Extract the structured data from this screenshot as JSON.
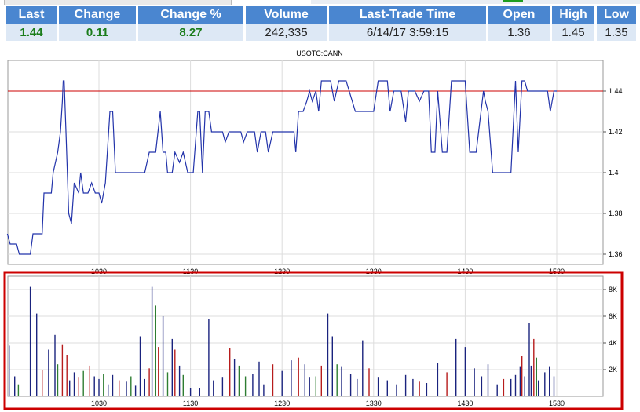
{
  "quote": {
    "headers": [
      "Last",
      "Change",
      "Change %",
      "Volume",
      "Last-Trade Time",
      "Open",
      "High",
      "Low"
    ],
    "values": [
      "1.44",
      "0.11",
      "8.27",
      "242,335",
      "6/14/17 3:59:15",
      "1.36",
      "1.45",
      "1.35"
    ]
  },
  "chart_data": [
    {
      "type": "line",
      "title": "USOTC:CANN",
      "x_ticks": [
        "1030",
        "1130",
        "1230",
        "1330",
        "1430",
        "1530"
      ],
      "y_ticks": [
        "1.44",
        "1.42",
        "1.4",
        "1.38",
        "1.36"
      ],
      "ylim": [
        1.355,
        1.455
      ],
      "reference_line": 1.44,
      "grid": true,
      "series": [
        {
          "color": "#2233aa",
          "points": [
            [
              9.5,
              1.37
            ],
            [
              9.53,
              1.365
            ],
            [
              9.6,
              1.365
            ],
            [
              9.63,
              1.36
            ],
            [
              9.75,
              1.36
            ],
            [
              9.78,
              1.37
            ],
            [
              9.88,
              1.37
            ],
            [
              9.9,
              1.39
            ],
            [
              9.98,
              1.39
            ],
            [
              10.0,
              1.4
            ],
            [
              10.05,
              1.41
            ],
            [
              10.08,
              1.42
            ],
            [
              10.1,
              1.435
            ],
            [
              10.11,
              1.445
            ],
            [
              10.12,
              1.445
            ],
            [
              10.14,
              1.42
            ],
            [
              10.17,
              1.38
            ],
            [
              10.2,
              1.375
            ],
            [
              10.23,
              1.395
            ],
            [
              10.28,
              1.39
            ],
            [
              10.3,
              1.4
            ],
            [
              10.33,
              1.39
            ],
            [
              10.38,
              1.39
            ],
            [
              10.42,
              1.395
            ],
            [
              10.46,
              1.39
            ],
            [
              10.5,
              1.39
            ],
            [
              10.53,
              1.385
            ],
            [
              10.57,
              1.395
            ],
            [
              10.62,
              1.43
            ],
            [
              10.65,
              1.43
            ],
            [
              10.68,
              1.4
            ],
            [
              10.78,
              1.4
            ],
            [
              10.92,
              1.4
            ],
            [
              10.97,
              1.4
            ],
            [
              11.0,
              1.4
            ],
            [
              11.05,
              1.41
            ],
            [
              11.12,
              1.41
            ],
            [
              11.17,
              1.43
            ],
            [
              11.2,
              1.41
            ],
            [
              11.23,
              1.41
            ],
            [
              11.25,
              1.4
            ],
            [
              11.3,
              1.4
            ],
            [
              11.33,
              1.41
            ],
            [
              11.38,
              1.405
            ],
            [
              11.42,
              1.41
            ],
            [
              11.47,
              1.4
            ],
            [
              11.53,
              1.4
            ],
            [
              11.58,
              1.43
            ],
            [
              11.6,
              1.43
            ],
            [
              11.63,
              1.4
            ],
            [
              11.66,
              1.43
            ],
            [
              11.7,
              1.43
            ],
            [
              11.73,
              1.42
            ],
            [
              11.85,
              1.42
            ],
            [
              11.88,
              1.415
            ],
            [
              11.92,
              1.42
            ],
            [
              12.05,
              1.42
            ],
            [
              12.08,
              1.415
            ],
            [
              12.12,
              1.42
            ],
            [
              12.2,
              1.42
            ],
            [
              12.23,
              1.41
            ],
            [
              12.27,
              1.42
            ],
            [
              12.32,
              1.42
            ],
            [
              12.35,
              1.41
            ],
            [
              12.4,
              1.42
            ],
            [
              12.5,
              1.42
            ],
            [
              12.63,
              1.42
            ],
            [
              12.65,
              1.41
            ],
            [
              12.68,
              1.43
            ],
            [
              12.73,
              1.43
            ],
            [
              12.77,
              1.435
            ],
            [
              12.8,
              1.44
            ],
            [
              12.83,
              1.435
            ],
            [
              12.87,
              1.44
            ],
            [
              12.9,
              1.43
            ],
            [
              12.93,
              1.445
            ],
            [
              12.98,
              1.445
            ],
            [
              13.03,
              1.445
            ],
            [
              13.07,
              1.435
            ],
            [
              13.12,
              1.445
            ],
            [
              13.2,
              1.445
            ],
            [
              13.3,
              1.43
            ],
            [
              13.45,
              1.43
            ],
            [
              13.5,
              1.43
            ],
            [
              13.55,
              1.445
            ],
            [
              13.65,
              1.445
            ],
            [
              13.68,
              1.43
            ],
            [
              13.72,
              1.44
            ],
            [
              13.8,
              1.44
            ],
            [
              13.85,
              1.425
            ],
            [
              13.88,
              1.44
            ],
            [
              13.95,
              1.44
            ],
            [
              14.0,
              1.435
            ],
            [
              14.05,
              1.44
            ],
            [
              14.1,
              1.44
            ],
            [
              14.13,
              1.41
            ],
            [
              14.17,
              1.41
            ],
            [
              14.2,
              1.44
            ],
            [
              14.25,
              1.41
            ],
            [
              14.3,
              1.41
            ],
            [
              14.35,
              1.445
            ],
            [
              14.5,
              1.445
            ],
            [
              14.55,
              1.41
            ],
            [
              14.62,
              1.41
            ],
            [
              14.7,
              1.44
            ],
            [
              14.72,
              1.435
            ],
            [
              14.75,
              1.43
            ],
            [
              14.8,
              1.4
            ],
            [
              14.95,
              1.4
            ],
            [
              15.0,
              1.4
            ],
            [
              15.05,
              1.445
            ],
            [
              15.08,
              1.41
            ],
            [
              15.12,
              1.445
            ],
            [
              15.15,
              1.445
            ],
            [
              15.18,
              1.44
            ],
            [
              15.25,
              1.44
            ],
            [
              15.4,
              1.44
            ],
            [
              15.43,
              1.43
            ],
            [
              15.47,
              1.44
            ],
            [
              15.5,
              1.44
            ]
          ]
        }
      ]
    },
    {
      "type": "bar",
      "x_ticks": [
        "1030",
        "1130",
        "1230",
        "1330",
        "1430",
        "1530"
      ],
      "y_ticks": [
        "8K",
        "6K",
        "4K",
        "2K"
      ],
      "ylim": [
        0,
        9000
      ],
      "grid": true,
      "series": [
        {
          "name": "",
          "bars": [
            [
              9.52,
              3800,
              "#1a237e"
            ],
            [
              9.58,
              1500,
              "#1a237e"
            ],
            [
              9.62,
              900,
              "#2e7d32"
            ],
            [
              9.75,
              8200,
              "#1a237e"
            ],
            [
              9.82,
              6200,
              "#1a237e"
            ],
            [
              9.88,
              2000,
              "#b71c1c"
            ],
            [
              9.95,
              3500,
              "#1a237e"
            ],
            [
              10.02,
              4600,
              "#1a237e"
            ],
            [
              10.05,
              2400,
              "#2e7d32"
            ],
            [
              10.1,
              3900,
              "#b71c1c"
            ],
            [
              10.15,
              3100,
              "#b71c1c"
            ],
            [
              10.18,
              1200,
              "#1a237e"
            ],
            [
              10.23,
              1800,
              "#1a237e"
            ],
            [
              10.28,
              1400,
              "#b71c1c"
            ],
            [
              10.33,
              1900,
              "#2e7d32"
            ],
            [
              10.4,
              2300,
              "#b71c1c"
            ],
            [
              10.45,
              1500,
              "#1a237e"
            ],
            [
              10.5,
              1300,
              "#1a237e"
            ],
            [
              10.55,
              1700,
              "#2e7d32"
            ],
            [
              10.6,
              900,
              "#1a237e"
            ],
            [
              10.65,
              1600,
              "#1a237e"
            ],
            [
              10.72,
              1200,
              "#b71c1c"
            ],
            [
              10.8,
              1100,
              "#1a237e"
            ],
            [
              10.85,
              1500,
              "#2e7d32"
            ],
            [
              10.9,
              800,
              "#1a237e"
            ],
            [
              10.95,
              4500,
              "#1a237e"
            ],
            [
              11.0,
              1300,
              "#1a237e"
            ],
            [
              11.05,
              2100,
              "#b71c1c"
            ],
            [
              11.08,
              8200,
              "#1a237e"
            ],
            [
              11.12,
              6800,
              "#2e7d32"
            ],
            [
              11.15,
              3700,
              "#b71c1c"
            ],
            [
              11.2,
              6000,
              "#1a237e"
            ],
            [
              11.25,
              1800,
              "#2e7d32"
            ],
            [
              11.3,
              4300,
              "#1a237e"
            ],
            [
              11.33,
              3500,
              "#b71c1c"
            ],
            [
              11.38,
              2300,
              "#1a237e"
            ],
            [
              11.42,
              1600,
              "#2e7d32"
            ],
            [
              11.5,
              600,
              "#1a237e"
            ],
            [
              11.6,
              600,
              "#1a237e"
            ],
            [
              11.7,
              5800,
              "#1a237e"
            ],
            [
              11.75,
              1200,
              "#1a237e"
            ],
            [
              11.85,
              1400,
              "#1a237e"
            ],
            [
              11.93,
              3600,
              "#b71c1c"
            ],
            [
              11.98,
              2800,
              "#1a237e"
            ],
            [
              12.03,
              2300,
              "#2e7d32"
            ],
            [
              12.1,
              1500,
              "#2e7d32"
            ],
            [
              12.18,
              1700,
              "#1a237e"
            ],
            [
              12.25,
              2600,
              "#1a237e"
            ],
            [
              12.3,
              900,
              "#1a237e"
            ],
            [
              12.4,
              2400,
              "#b71c1c"
            ],
            [
              12.5,
              1900,
              "#1a237e"
            ],
            [
              12.6,
              2700,
              "#1a237e"
            ],
            [
              12.68,
              2900,
              "#b71c1c"
            ],
            [
              12.75,
              2400,
              "#1a237e"
            ],
            [
              12.8,
              1400,
              "#1a237e"
            ],
            [
              12.87,
              1500,
              "#2e7d32"
            ],
            [
              12.93,
              2300,
              "#b71c1c"
            ],
            [
              13.0,
              6200,
              "#1a237e"
            ],
            [
              13.05,
              4500,
              "#1a237e"
            ],
            [
              13.1,
              2400,
              "#2e7d32"
            ],
            [
              13.15,
              2200,
              "#1a237e"
            ],
            [
              13.25,
              1700,
              "#1a237e"
            ],
            [
              13.32,
              1300,
              "#1a237e"
            ],
            [
              13.38,
              4200,
              "#1a237e"
            ],
            [
              13.45,
              2100,
              "#b71c1c"
            ],
            [
              13.55,
              1400,
              "#1a237e"
            ],
            [
              13.65,
              1200,
              "#1a237e"
            ],
            [
              13.75,
              900,
              "#1a237e"
            ],
            [
              13.85,
              1600,
              "#1a237e"
            ],
            [
              13.93,
              1300,
              "#1a237e"
            ],
            [
              14.0,
              1100,
              "#b71c1c"
            ],
            [
              14.08,
              1000,
              "#1a237e"
            ],
            [
              14.2,
              2500,
              "#1a237e"
            ],
            [
              14.3,
              1800,
              "#b71c1c"
            ],
            [
              14.4,
              4300,
              "#1a237e"
            ],
            [
              14.5,
              3700,
              "#1a237e"
            ],
            [
              14.6,
              2100,
              "#1a237e"
            ],
            [
              14.68,
              1500,
              "#1a237e"
            ],
            [
              14.75,
              2400,
              "#1a237e"
            ],
            [
              14.85,
              900,
              "#1a237e"
            ],
            [
              14.92,
              1300,
              "#b71c1c"
            ],
            [
              15.0,
              1300,
              "#1a237e"
            ],
            [
              15.05,
              1600,
              "#1a237e"
            ],
            [
              15.1,
              2200,
              "#1a237e"
            ],
            [
              15.15,
              1500,
              "#1a237e"
            ],
            [
              15.22,
              2300,
              "#1a237e"
            ],
            [
              15.3,
              1200,
              "#1a237e"
            ],
            [
              15.37,
              1800,
              "#1a237e"
            ],
            [
              15.42,
              2200,
              "#1a237e"
            ],
            [
              15.47,
              1500,
              "#1a237e"
            ],
            [
              15.2,
              5500,
              "#1a237e"
            ],
            [
              15.12,
              3000,
              "#b71c1c"
            ],
            [
              15.25,
              4300,
              "#b71c1c"
            ],
            [
              15.28,
              2900,
              "#2e7d32"
            ]
          ]
        }
      ]
    }
  ],
  "colors": {
    "header_bg": "#4a86d0",
    "cell_bg": "#dde8f5",
    "positive": "#1b7d1b",
    "price_line": "#2233aa",
    "ref_line": "#cc0000",
    "highlight_box": "#cc0000"
  }
}
